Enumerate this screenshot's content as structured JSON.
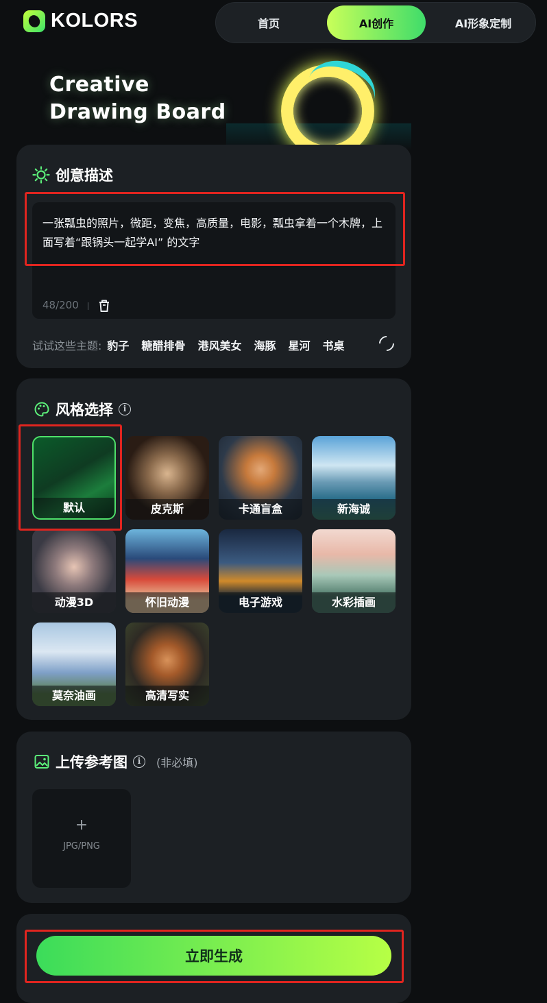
{
  "header": {
    "logo_text": "KOLORS",
    "nav": [
      {
        "label": "首页"
      },
      {
        "label": "AI创作"
      },
      {
        "label": "AI形象定制"
      }
    ]
  },
  "hero": {
    "line1": "Creative",
    "line2": "Drawing Board"
  },
  "prompt_card": {
    "title": "创意描述",
    "text": "一张瓢虫的照片，微距，变焦，高质量，电影，瓢虫拿着一个木牌，上面写着“跟锅头一起学AI” 的文字",
    "counter": "48/200",
    "topics_label": "试试这些主题:",
    "topics": [
      "豹子",
      "糖醋排骨",
      "港风美女",
      "海豚",
      "星河",
      "书桌"
    ]
  },
  "style_card": {
    "title": "风格选择",
    "info": "i",
    "styles": [
      {
        "label": "默认"
      },
      {
        "label": "皮克斯"
      },
      {
        "label": "卡通盲盒"
      },
      {
        "label": "新海诚"
      },
      {
        "label": "动漫3D"
      },
      {
        "label": "怀旧动漫"
      },
      {
        "label": "电子游戏"
      },
      {
        "label": "水彩插画"
      },
      {
        "label": "莫奈油画"
      },
      {
        "label": "高清写实"
      }
    ],
    "selected": "默认"
  },
  "upload_card": {
    "title": "上传参考图",
    "info": "i",
    "optional": "(非必填)",
    "plus": "+",
    "formats": "JPG/PNG"
  },
  "generate_label": "立即生成",
  "colors": {
    "accent_start": "#3bdc5a",
    "accent_end": "#b7ff45",
    "highlight": "#e0251f"
  }
}
